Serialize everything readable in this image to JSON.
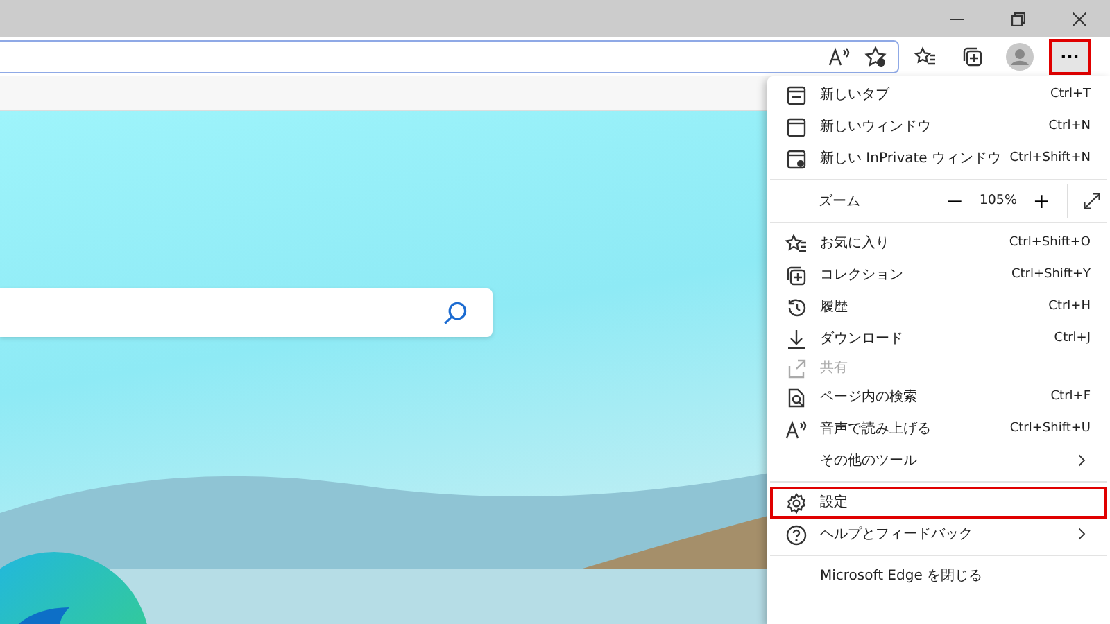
{
  "toolbar": {
    "more_button": {
      "label": "···",
      "highlighted": true
    }
  },
  "menu": {
    "items": [
      {
        "kind": "item",
        "label": "新しいタブ",
        "shortcut": "Ctrl+T",
        "disabled": false,
        "submenu": false,
        "highlighted": false
      },
      {
        "kind": "item",
        "label": "新しいウィンドウ",
        "shortcut": "Ctrl+N",
        "disabled": false,
        "submenu": false,
        "highlighted": false
      },
      {
        "kind": "item",
        "label": "新しい InPrivate ウィンドウ",
        "shortcut": "Ctrl+Shift+N",
        "disabled": false,
        "submenu": false,
        "highlighted": false
      },
      {
        "kind": "divider"
      },
      {
        "kind": "zoom",
        "label": "ズーム",
        "minus": "−",
        "value": "105%",
        "plus": "+"
      },
      {
        "kind": "divider"
      },
      {
        "kind": "item",
        "label": "お気に入り",
        "shortcut": "Ctrl+Shift+O",
        "disabled": false,
        "submenu": false,
        "highlighted": false
      },
      {
        "kind": "item",
        "label": "コレクション",
        "shortcut": "Ctrl+Shift+Y",
        "disabled": false,
        "submenu": false,
        "highlighted": false
      },
      {
        "kind": "item",
        "label": "履歴",
        "shortcut": "Ctrl+H",
        "disabled": false,
        "submenu": false,
        "highlighted": false
      },
      {
        "kind": "item",
        "label": "ダウンロード",
        "shortcut": "Ctrl+J",
        "disabled": false,
        "submenu": false,
        "highlighted": false
      },
      {
        "kind": "item",
        "label": "共有",
        "disabled": true,
        "submenu": false,
        "highlighted": false
      },
      {
        "kind": "item",
        "label": "ページ内の検索",
        "shortcut": "Ctrl+F",
        "disabled": false,
        "submenu": false,
        "highlighted": false
      },
      {
        "kind": "item",
        "label": "音声で読み上げる",
        "shortcut": "Ctrl+Shift+U",
        "disabled": false,
        "submenu": false,
        "highlighted": false
      },
      {
        "kind": "item",
        "label": "その他のツール",
        "disabled": false,
        "submenu": true,
        "highlighted": false
      },
      {
        "kind": "divider"
      },
      {
        "kind": "item",
        "label": "設定",
        "disabled": false,
        "submenu": false,
        "highlighted": true
      },
      {
        "kind": "item",
        "label": "ヘルプとフィードバック",
        "disabled": false,
        "submenu": true,
        "highlighted": false
      },
      {
        "kind": "divider"
      },
      {
        "kind": "item",
        "label": "Microsoft Edge を閉じる",
        "disabled": false,
        "submenu": false,
        "highlighted": false
      }
    ]
  }
}
